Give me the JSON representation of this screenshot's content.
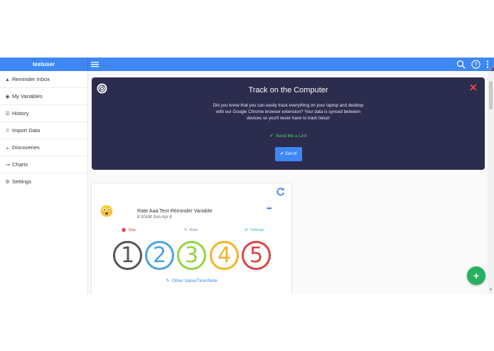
{
  "header": {
    "user_name": "testuser"
  },
  "sidebar": {
    "items": [
      {
        "label": "Reminder Inbox",
        "icon": "inbox-icon"
      },
      {
        "label": "My Variables",
        "icon": "variables-icon"
      },
      {
        "label": "History",
        "icon": "history-icon"
      },
      {
        "label": "Import Data",
        "icon": "import-icon"
      },
      {
        "label": "Discoveries",
        "icon": "discoveries-icon"
      },
      {
        "label": "Charts",
        "icon": "chart-icon"
      },
      {
        "label": "Settings",
        "icon": "settings-icon"
      }
    ]
  },
  "promo": {
    "title": "Track on the Computer",
    "body": "Did you know that you can easily track everything on your laptop and desktop with our Google Chrome browser extension? Your data is synced between devices so you'll never have to track twice!",
    "send_link_label": "Send Me a Link",
    "got_it_label": "Got it!"
  },
  "reminder": {
    "title": "Rate Aaa Test Reminder Variable",
    "time": "8:30AM Sun Apr 8",
    "more_label": "•••",
    "skip_label": "Skip",
    "note_label": "Note",
    "settings_label": "Settings",
    "ratings": [
      "1",
      "2",
      "3",
      "4",
      "5"
    ],
    "other_value_label": "Other Value/Time/Note"
  },
  "colors": {
    "topbar": "#3f87f5",
    "promo_bg": "#2b2c4e",
    "fab": "#25b25f",
    "close": "#f04747"
  }
}
